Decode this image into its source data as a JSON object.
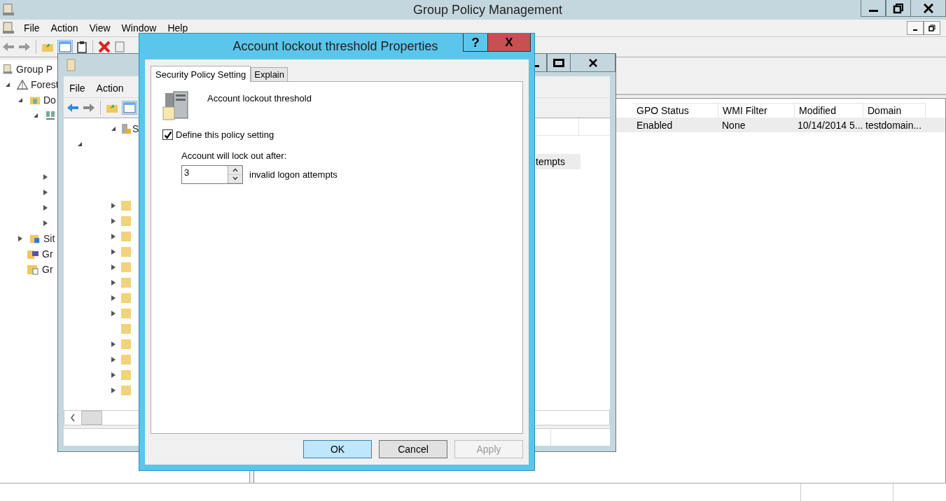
{
  "main_window": {
    "title": "Group Policy Management",
    "menu": [
      "File",
      "Action",
      "View",
      "Window",
      "Help"
    ],
    "tree": [
      {
        "label": "Group P",
        "children": [
          {
            "label": "Forest",
            "expanded": true,
            "children": [
              {
                "label": "Do",
                "expanded": true
              },
              {
                "label": "Sit",
                "expanded": false
              },
              {
                "label": "Gr"
              },
              {
                "label": "Gr"
              }
            ]
          }
        ]
      }
    ],
    "table": {
      "columns": [
        "GPO Status",
        "WMI Filter",
        "Modified",
        "Domain"
      ],
      "rows": [
        {
          "cells": [
            "Enabled",
            "None",
            "10/14/2014 5...",
            "testdomain..."
          ],
          "selected": true
        }
      ]
    }
  },
  "editor_window": {
    "menu": [
      "File",
      "Action"
    ],
    "tree": [
      {
        "label": "S",
        "expanded": true
      },
      {
        "expanded": false
      },
      {
        "expanded": false
      },
      {
        "expanded": false
      },
      {
        "expanded": false
      },
      {
        "expanded": false
      },
      {
        "expanded": false
      },
      {
        "expanded": false
      },
      {
        "expanded": false
      },
      {
        "leaf": true
      },
      {
        "expanded": false
      },
      {
        "expanded": false
      },
      {
        "expanded": false
      },
      {
        "expanded": false
      }
    ],
    "list_row": {
      "text": "tempts",
      "selected": true
    }
  },
  "dialog": {
    "title": "Account lockout threshold Properties",
    "help_button": "?",
    "close_button": "X",
    "tabs": [
      {
        "label": "Security Policy Setting",
        "selected": true
      },
      {
        "label": "Explain",
        "selected": false
      }
    ],
    "policy_name": "Account lockout threshold",
    "define_setting": {
      "label": "Define this policy setting",
      "checked": true
    },
    "lockout_label": "Account will lock out after:",
    "threshold": {
      "value": "3",
      "suffix": "invalid logon attempts"
    },
    "buttons": [
      {
        "label": "OK",
        "kind": "default",
        "disabled": false
      },
      {
        "label": "Cancel",
        "kind": "normal",
        "disabled": false
      },
      {
        "label": "Apply",
        "kind": "normal",
        "disabled": true
      }
    ]
  }
}
